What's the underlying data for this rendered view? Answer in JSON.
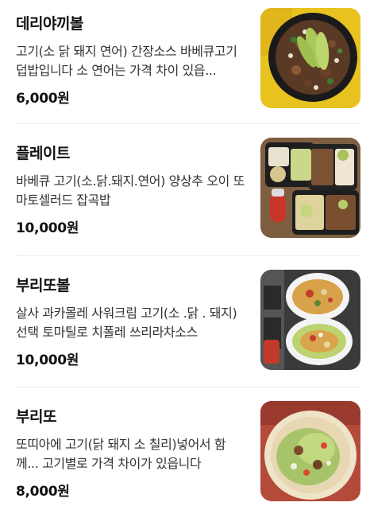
{
  "menu": {
    "items": [
      {
        "name": "데리야끼볼",
        "description": "고기(소 닭 돼지 연어) 간장소스 바베큐고기 덥밥입니다 소 연어는 가격 차이 있읍...",
        "price": "6,000원",
        "image": "teriyaki-bowl-photo"
      },
      {
        "name": "플레이트",
        "description": "바베큐 고기(소.닭.돼지.연어) 양상추 오이 또마토셀러드 잡곡밥",
        "price": "10,000원",
        "image": "plate-photo"
      },
      {
        "name": "부리또볼",
        "description": "살사 과카몰레 사워크림 고기(소 .닭 . 돼지)선택 토마틸로 치폴레 쓰리라차소스",
        "price": "10,000원",
        "image": "burrito-bowl-photo"
      },
      {
        "name": "부리또",
        "description": "또띠아에 고기(닭 돼지 소 칠리)넣어서 함께... 고기별로 가격 차이가 있읍니다",
        "price": "8,000원",
        "image": "burrito-photo"
      }
    ]
  }
}
